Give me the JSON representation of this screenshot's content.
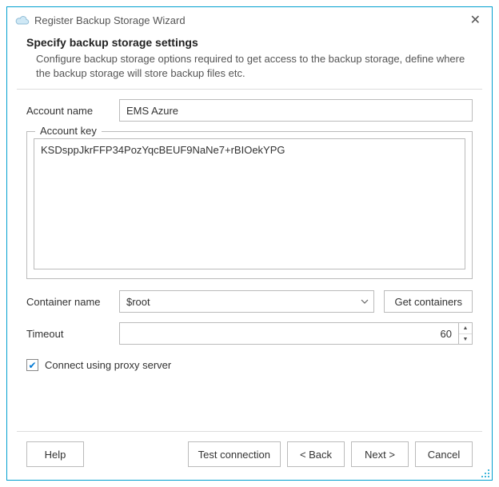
{
  "window": {
    "title": "Register Backup Storage Wizard"
  },
  "header": {
    "heading": "Specify backup storage settings",
    "description": "Configure backup storage options required to get access to the backup storage, define where the backup storage will store backup files etc."
  },
  "form": {
    "account_name_label": "Account name",
    "account_name_value": "EMS Azure",
    "account_key_label": "Account key",
    "account_key_value": "KSDsppJkrFFP34PozYqcBEUF9NaNe7+rBIOekYPG",
    "container_name_label": "Container name",
    "container_name_value": "$root",
    "get_containers_label": "Get containers",
    "timeout_label": "Timeout",
    "timeout_value": "60",
    "proxy_checked": true,
    "proxy_label": "Connect using proxy server"
  },
  "footer": {
    "help": "Help",
    "test": "Test connection",
    "back": "< Back",
    "next": "Next >",
    "cancel": "Cancel"
  }
}
